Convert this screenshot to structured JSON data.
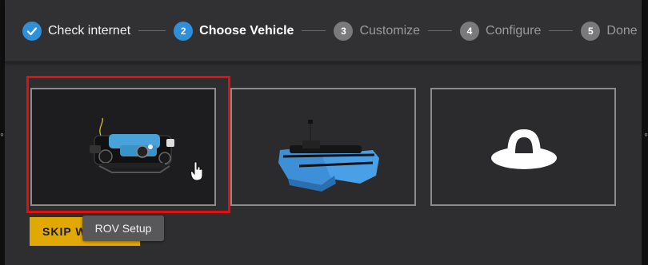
{
  "stepper": {
    "steps": [
      {
        "number": "",
        "label": "Check internet",
        "state": "done"
      },
      {
        "number": "2",
        "label": "Choose Vehicle",
        "state": "active"
      },
      {
        "number": "3",
        "label": "Customize",
        "state": "pending"
      },
      {
        "number": "4",
        "label": "Configure",
        "state": "pending"
      },
      {
        "number": "5",
        "label": "Done",
        "state": "pending"
      }
    ]
  },
  "vehicles": [
    {
      "icon": "rov-vehicle-icon",
      "selected": true
    },
    {
      "icon": "boat-vehicle-icon",
      "selected": false
    },
    {
      "icon": "generic-vehicle-icon",
      "selected": false
    }
  ],
  "tooltip": "ROV Setup",
  "skip_button_label": "SKIP WIZARD",
  "colors": {
    "accent": "#2f8fd8",
    "selection": "#e01010",
    "skip_button": "#e0a800"
  }
}
